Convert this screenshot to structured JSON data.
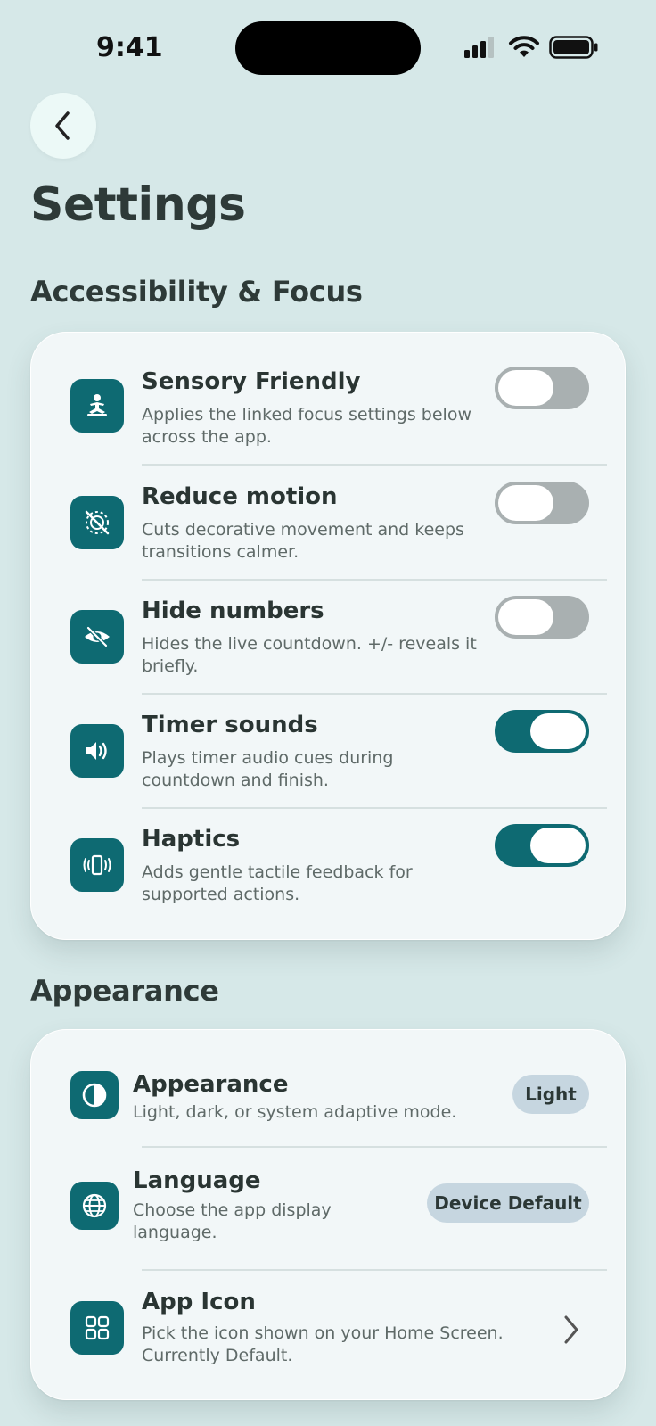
{
  "status_bar": {
    "time": "9:41"
  },
  "page_title": "Settings",
  "sections": {
    "accessibility": {
      "title": "Accessibility & Focus",
      "rows": [
        {
          "title": "Sensory Friendly",
          "description": "Applies the linked focus settings below across the app.",
          "icon": "meditation-icon",
          "enabled": false
        },
        {
          "title": "Reduce motion",
          "description": "Cuts decorative movement and keeps transitions calmer.",
          "icon": "motion-off-icon",
          "enabled": false
        },
        {
          "title": "Hide numbers",
          "description": "Hides the live countdown. +/- reveals it briefly.",
          "icon": "eye-slash-icon",
          "enabled": false
        },
        {
          "title": "Timer sounds",
          "description": "Plays timer audio cues during countdown and finish.",
          "icon": "speaker-icon",
          "enabled": true
        },
        {
          "title": "Haptics",
          "description": "Adds gentle tactile feedback for supported actions.",
          "icon": "phone-vibrate-icon",
          "enabled": true
        }
      ]
    },
    "appearance": {
      "title": "Appearance",
      "rows": [
        {
          "title": "Appearance",
          "description": "Light, dark, or system adaptive mode.",
          "icon": "contrast-icon",
          "value": "Light"
        },
        {
          "title": "Language",
          "description": "Choose the app display language.",
          "icon": "globe-icon",
          "value": "Device Default"
        },
        {
          "title": "App Icon",
          "description": "Pick the icon shown on your Home Screen. Currently Default.",
          "icon": "grid-icon"
        }
      ]
    }
  },
  "colors": {
    "accent": "#0e6a72",
    "background": "#d6e8e8",
    "card": "#f2f7f8",
    "toggle_off": "#a9b0b1",
    "pill": "#c6d6e0"
  }
}
